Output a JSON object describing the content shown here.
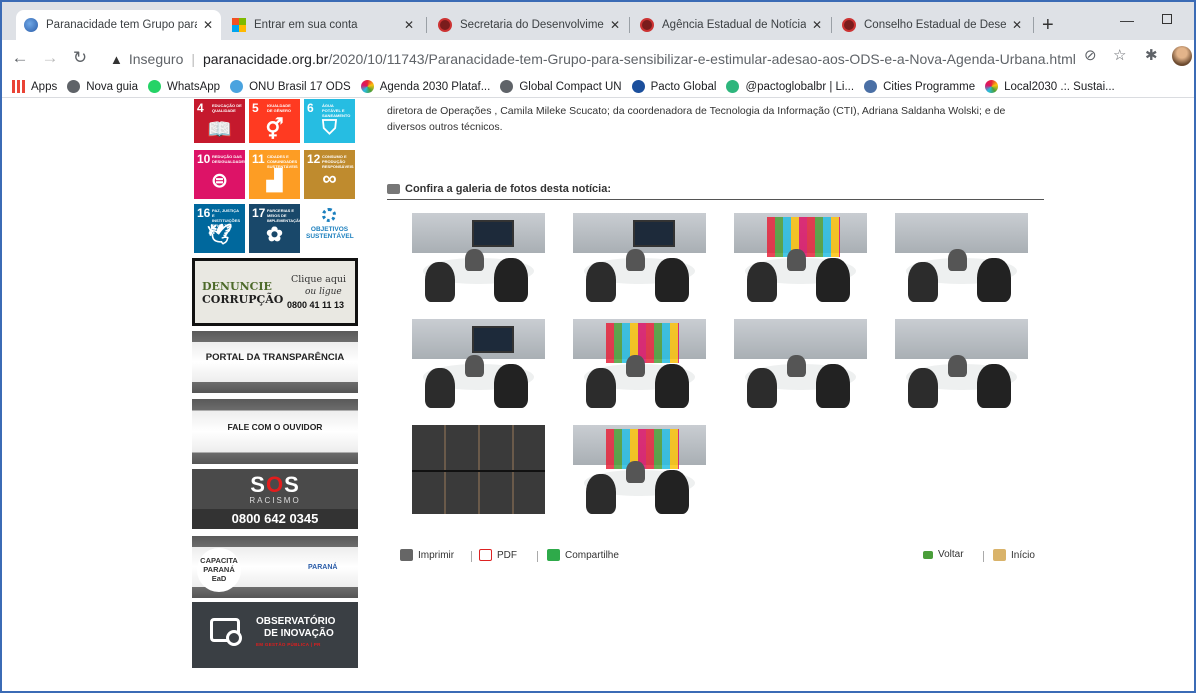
{
  "tabs": [
    {
      "title": "Paranacidade tem Grupo para",
      "active": true,
      "icon": "globe-icon"
    },
    {
      "title": "Entrar em sua conta",
      "active": false,
      "icon": "microsoft-icon"
    },
    {
      "title": "Secretaria do Desenvolvimento",
      "active": false,
      "icon": "parana-crest-icon"
    },
    {
      "title": "Agência Estadual de Notícias",
      "active": false,
      "icon": "parana-crest-icon"
    },
    {
      "title": "Conselho Estadual de Desenv",
      "active": false,
      "icon": "parana-crest-icon"
    }
  ],
  "address": {
    "security_label": "Inseguro",
    "host": "paranacidade.org.br",
    "path": "/2020/10/11743/Paranacidade-tem-Grupo-para-sensibilizar-e-estimular-adesao-aos-ODS-e-a-Nova-Agenda-Urbana.html"
  },
  "bookmarks": [
    {
      "label": "Apps",
      "color": "#ea4335"
    },
    {
      "label": "Nova guia",
      "color": "#5f6368"
    },
    {
      "label": "WhatsApp",
      "color": "#25d366"
    },
    {
      "label": "ONU Brasil 17 ODS",
      "color": "#4aa3df"
    },
    {
      "label": "Agenda 2030 Plataf...",
      "color": "#f4a11d"
    },
    {
      "label": "Global Compact UN",
      "color": "#5f6368"
    },
    {
      "label": "Pacto Global",
      "color": "#1b4f9c"
    },
    {
      "label": "@pactoglobalbr | Li...",
      "color": "#2eb67d"
    },
    {
      "label": "Cities Programme",
      "color": "#4a6fa5"
    },
    {
      "label": "Local2030 .:. Sustai...",
      "color": "#f4a11d"
    }
  ],
  "sidebar": {
    "sdgs": [
      {
        "num": "4",
        "label": "EDUCAÇÃO DE QUALIDADE",
        "color": "#c5192d",
        "icon": "📖"
      },
      {
        "num": "5",
        "label": "IGUALDADE DE GÊNERO",
        "color": "#ff3a21",
        "icon": "⚥"
      },
      {
        "num": "6",
        "label": "ÁGUA POTÁVEL E SANEAMENTO",
        "color": "#26bde2",
        "icon": "⛉"
      },
      {
        "num": "10",
        "label": "REDUÇÃO DAS DESIGUALDADES",
        "color": "#dd1367",
        "icon": "⊜"
      },
      {
        "num": "11",
        "label": "CIDADES E COMUNIDADES SUSTENTÁVEIS",
        "color": "#fd9d24",
        "icon": "▟"
      },
      {
        "num": "12",
        "label": "CONSUMO E PRODUÇÃO RESPONSÁVEIS",
        "color": "#bf8b2e",
        "icon": "∞"
      },
      {
        "num": "16",
        "label": "PAZ, JUSTIÇA E INSTITUIÇÕES EFICAZES",
        "color": "#00689d",
        "icon": "🕊"
      },
      {
        "num": "17",
        "label": "PARCERIAS E MEIOS DE IMPLEMENTAÇÃO",
        "color": "#19486a",
        "icon": "✿"
      }
    ],
    "sdg_logo": "OBJETIVOS SUSTENTÁVEL",
    "denuncie": {
      "line1": "DENUNCIE",
      "line2": "CORRUPÇÃO",
      "line3": "Clique aqui",
      "line4": "ou ligue",
      "phone": "0800 41 11 13"
    },
    "portal": "PORTAL DA TRANSPARÊNCIA",
    "ouvidor": "FALE COM O OUVIDOR",
    "sos": {
      "logo_s1": "S",
      "logo_o": "O",
      "logo_s2": "S",
      "sub": "RACISMO",
      "phone": "0800 642 0345"
    },
    "capacita": {
      "title": "CAPACITA PARANÁ EaD",
      "brand": "PARANÁ"
    },
    "observatorio": {
      "line1": "OBSERVATÓRIO",
      "line2": "DE INOVAÇÃO",
      "line3": "EM GESTÃO PÚBLICA | PR"
    }
  },
  "article": {
    "text": "diretora de Operações , Camila Mileke Scucato; da coordenadora de Tecnologia da Informação (CTI), Adriana Saldanha Wolski;  e de diversos outros técnicos.",
    "gallery_title": "Confira a galeria de fotos desta notícia:",
    "photo_count": 10
  },
  "actions": {
    "print": "Imprimir",
    "pdf": "PDF",
    "share": "Compartilhe",
    "back": "Voltar",
    "home": "Início"
  }
}
